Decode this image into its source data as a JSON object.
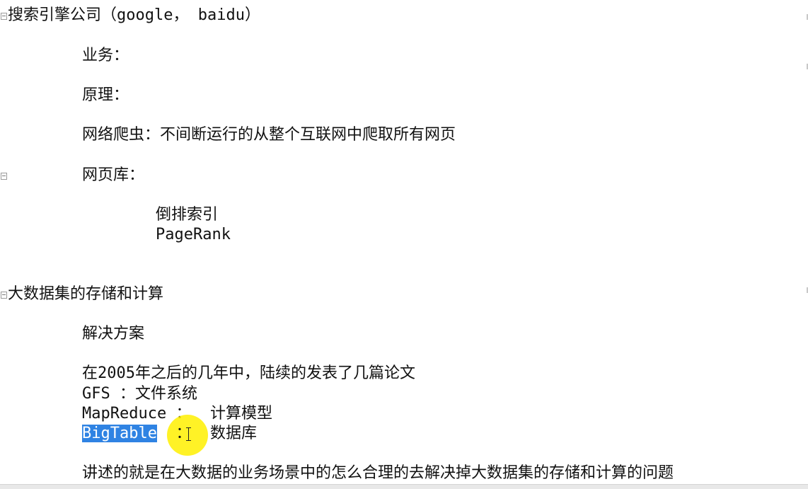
{
  "document": {
    "heading1": "搜索引擎公司（google， baidu）",
    "business": "业务：",
    "principle": "原理：",
    "crawler": "网络爬虫：不间断运行的从整个互联网中爬取所有网页",
    "webdb": "网页库：",
    "inverted_index": "倒排索引",
    "pagerank": "PageRank",
    "heading2": "大数据集的存储和计算",
    "solution": "解决方案",
    "papers_intro": "在2005年之后的几年中，陆续的发表了几篇论文",
    "gfs": "GFS ：文件系统",
    "mapreduce": "MapReduce ：  计算模型",
    "bigtable_name": "BigTable",
    "bigtable_rest": "  ：  数据库",
    "summary": "讲述的就是在大数据的业务场景中的怎么合理的去解决掉大数据集的存储和计算的问题"
  },
  "colors": {
    "selection": "#2f83e3",
    "cursor_highlight": "#fff000"
  },
  "icons": [
    "fold-collapse-icon",
    "text-cursor-icon"
  ]
}
